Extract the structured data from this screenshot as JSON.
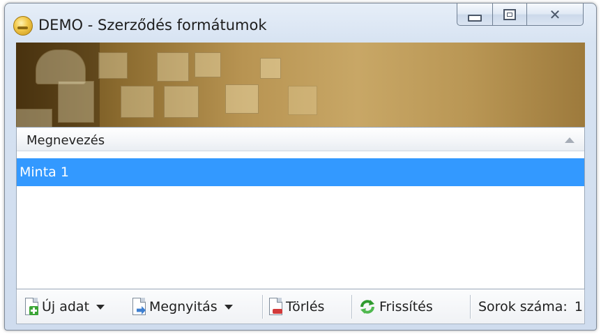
{
  "window": {
    "title": "DEMO - Szerződés formátumok"
  },
  "grid": {
    "columns": [
      "Megnevezés"
    ],
    "rows": [
      {
        "name": "Minta 1",
        "selected": true
      }
    ]
  },
  "toolbar": {
    "new_label": "Új adat",
    "open_label": "Megnyitás",
    "delete_label": "Törlés",
    "refresh_label": "Frissítés",
    "row_count_label": "Sorok száma:",
    "row_count_value": "1"
  },
  "icons": {
    "app": "app-coin-icon",
    "new": "new-document-icon",
    "open": "open-document-icon",
    "delete": "delete-document-icon",
    "refresh": "refresh-icon"
  },
  "colors": {
    "selection": "#3399ff",
    "banner_gold": "#b89452"
  }
}
